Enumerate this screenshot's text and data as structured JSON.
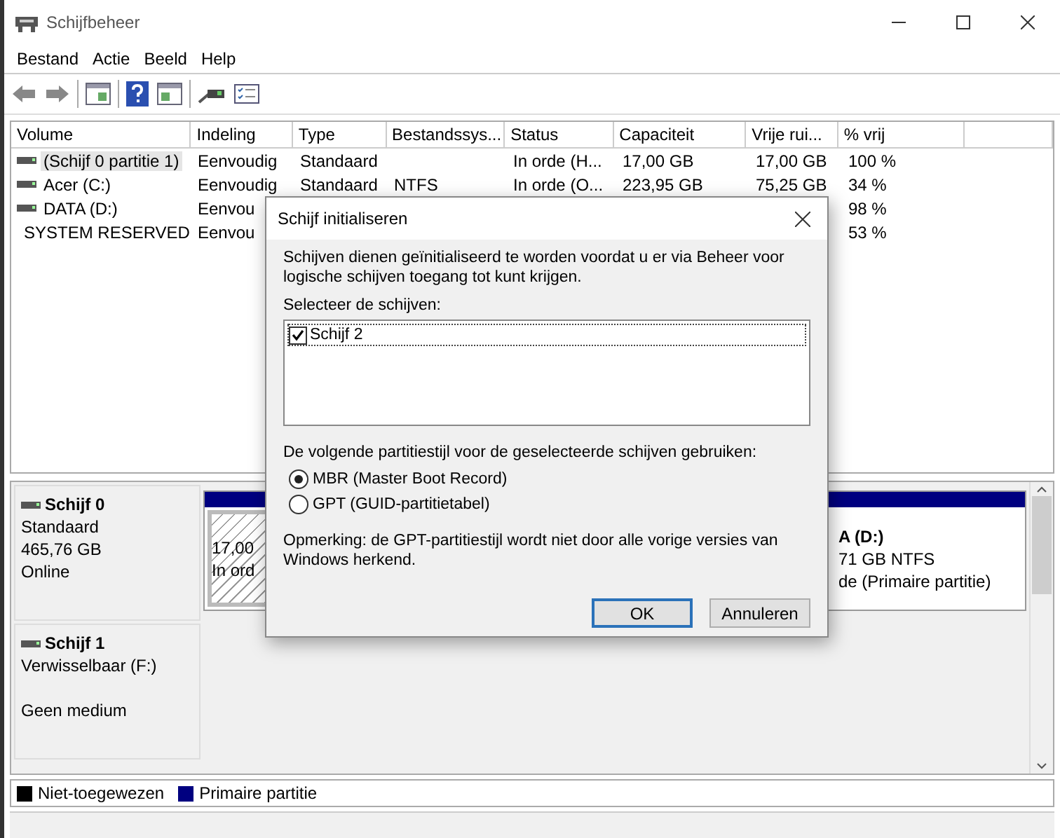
{
  "window": {
    "title": "Schijfbeheer"
  },
  "menu": [
    "Bestand",
    "Actie",
    "Beeld",
    "Help"
  ],
  "table": {
    "columns": [
      "Volume",
      "Indeling",
      "Type",
      "Bestandssys...",
      "Status",
      "Capaciteit",
      "Vrije rui...",
      "% vrij"
    ],
    "rows": [
      {
        "volume": "(Schijf 0 partitie 1)",
        "indeling": "Eenvoudig",
        "type": "Standaard",
        "status": "In orde (H...",
        "capaciteit": "17,00 GB",
        "vrije_ruimte": "17,00 GB",
        "pct_vrij": "100 %",
        "selected": true
      },
      {
        "volume": "Acer (C:)",
        "indeling": "Eenvoudig",
        "type": "Standaard",
        "bestandssysteem": "NTFS",
        "status": "In orde (O...",
        "capaciteit": "223,95 GB",
        "vrije_ruimte": "75,25 GB",
        "pct_vrij": "34 %",
        "selected": false
      },
      {
        "volume": "DATA (D:)",
        "indeling": "Eenvou",
        "pct_vrij": "98 %",
        "selected": false
      },
      {
        "volume": "SYSTEM RESERVED",
        "indeling": "Eenvou",
        "pct_vrij": "53 %",
        "selected": false
      }
    ]
  },
  "disks": [
    {
      "name": "Schijf 0",
      "type": "Standaard",
      "size": "465,76 GB",
      "status": "Online",
      "partitions": [
        {
          "kind": "primary",
          "selected": true,
          "lines": [
            "17,00",
            "In ord"
          ]
        },
        {
          "kind": "primary",
          "selected": false,
          "lines": [
            "A  (D:)",
            "71 GB NTFS",
            "de (Primaire partitie)"
          ]
        }
      ]
    },
    {
      "name": "Schijf 1",
      "type": "Verwisselbaar (F:)",
      "status": "Geen medium"
    }
  ],
  "legend": [
    {
      "label": "Niet-toegewezen",
      "color": "#000000"
    },
    {
      "label": "Primaire partitie",
      "color": "#000080"
    }
  ],
  "dialog": {
    "title": "Schijf initialiseren",
    "intro": "Schijven dienen geïnitialiseerd te worden voordat u er via Beheer voor logische schijven toegang tot kunt krijgen.",
    "select_label": "Selecteer de schijven:",
    "disks": [
      {
        "label": "Schijf 2",
        "checked": true
      }
    ],
    "style_label": "De volgende partitiestijl voor de geselecteerde schijven gebruiken:",
    "styles": [
      {
        "label": "MBR (Master Boot Record)",
        "selected": true
      },
      {
        "label": "GPT (GUID-partitietabel)",
        "selected": false
      }
    ],
    "note": "Opmerking: de GPT-partitiestijl wordt niet door alle vorige versies van Windows herkend.",
    "buttons": [
      {
        "label": "OK",
        "default": true
      },
      {
        "label": "Annuleren",
        "default": false
      }
    ]
  }
}
